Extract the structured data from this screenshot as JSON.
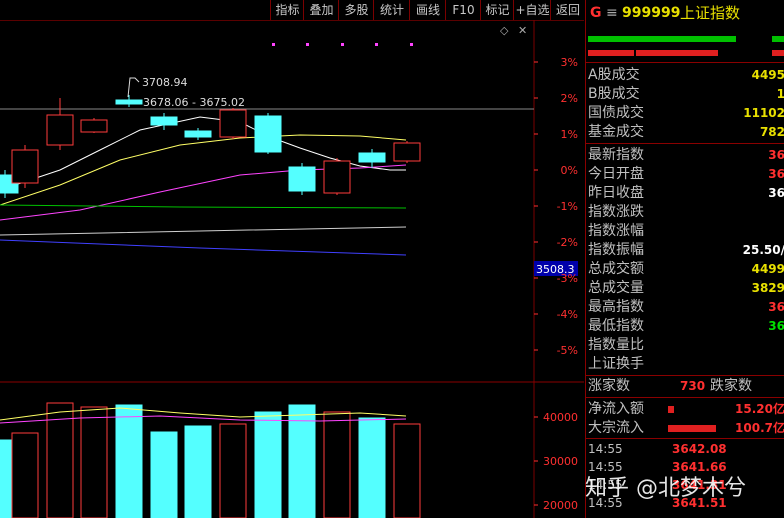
{
  "toolbar": {
    "buttons": [
      "指标",
      "叠加",
      "多股",
      "统计",
      "画线",
      "F10",
      "标记",
      "+自选",
      "返回"
    ]
  },
  "chart": {
    "high_label": "3708.94",
    "range_label": "3678.06 - 3675.02",
    "price_tag": "3508.3",
    "pct_axis": [
      "3%",
      "2%",
      "1%",
      "0%",
      "-1%",
      "-2%",
      "-3%",
      "-4%",
      "-5%"
    ],
    "vol_axis": [
      "40000",
      "30000",
      "20000"
    ]
  },
  "stock": {
    "prefix": "G",
    "menu_glyph": "≡",
    "code": "999999",
    "name": "上证指数"
  },
  "stats": [
    {
      "label": "A股成交",
      "value": "4495",
      "color": "#e8e000"
    },
    {
      "label": "B股成交",
      "value": "1",
      "color": "#e8e000"
    },
    {
      "label": "国债成交",
      "value": "11102",
      "color": "#e8e000"
    },
    {
      "label": "基金成交",
      "value": "782",
      "color": "#e8e000"
    }
  ],
  "index_info": [
    {
      "label": "最新指数",
      "value": "36",
      "color": "#ff3030"
    },
    {
      "label": "今日开盘",
      "value": "36",
      "color": "#ff3030"
    },
    {
      "label": "昨日收盘",
      "value": "36",
      "color": "#ffffff"
    },
    {
      "label": "指数涨跌",
      "value": "",
      "color": "#ff3030"
    },
    {
      "label": "指数涨幅",
      "value": "",
      "color": "#ff3030"
    },
    {
      "label": "指数振幅",
      "value": "25.50/",
      "color": "#ffffff"
    },
    {
      "label": "总成交额",
      "value": "4499",
      "color": "#e8e000"
    },
    {
      "label": "总成交量",
      "value": "3829",
      "color": "#e8e000"
    },
    {
      "label": "最高指数",
      "value": "36",
      "color": "#ff3030"
    },
    {
      "label": "最低指数",
      "value": "36",
      "color": "#00e000"
    },
    {
      "label": "指数量比",
      "value": "",
      "color": "#ffffff"
    },
    {
      "label": "上证换手",
      "value": "",
      "color": "#ffffff"
    }
  ],
  "breadth": {
    "up_label": "涨家数",
    "up_count": "730",
    "down_label": "跌家数"
  },
  "flows": [
    {
      "label": "净流入额",
      "value": "15.20亿",
      "color": "#ff3030"
    },
    {
      "label": "大宗流入",
      "value": "100.7亿",
      "color": "#ff3030"
    }
  ],
  "ticks": [
    {
      "time": "14:55",
      "price": "3642.08"
    },
    {
      "time": "14:55",
      "price": "3641.66"
    },
    {
      "time": "14:55",
      "price": "3641.31"
    },
    {
      "time": "14:55",
      "price": "3641.51"
    }
  ],
  "watermark": "知乎 @北梦木兮",
  "colors": {
    "up": "#ff3c3c",
    "down": "#54ffff",
    "ma5": "#ffffff",
    "ma10": "#ffff66",
    "ma20": "#ff44ff",
    "ma60": "#00c000",
    "ma120": "#d0d0d0",
    "ma250": "#4040ff"
  }
}
